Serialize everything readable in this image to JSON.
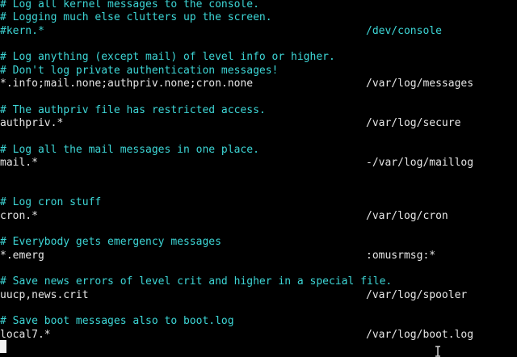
{
  "colors": {
    "background": "#000000",
    "comment": "#3dd6d6",
    "text": "#e6e6e6"
  },
  "lines": [
    {
      "kind": "comment",
      "text": "# Log all kernel messages to the console."
    },
    {
      "kind": "comment",
      "text": "# Logging much else clutters up the screen."
    },
    {
      "kind": "rule",
      "selector": "#kern.*",
      "action": "/dev/console",
      "selector_color": "comment",
      "action_color": "comment"
    },
    {
      "kind": "blank"
    },
    {
      "kind": "comment",
      "text": "# Log anything (except mail) of level info or higher."
    },
    {
      "kind": "comment",
      "text": "# Don't log private authentication messages!"
    },
    {
      "kind": "rule",
      "selector": "*.info;mail.none;authpriv.none;cron.none",
      "action": "/var/log/messages"
    },
    {
      "kind": "blank"
    },
    {
      "kind": "comment",
      "text": "# The authpriv file has restricted access."
    },
    {
      "kind": "rule",
      "selector": "authpriv.*",
      "action": "/var/log/secure"
    },
    {
      "kind": "blank"
    },
    {
      "kind": "comment",
      "text": "# Log all the mail messages in one place."
    },
    {
      "kind": "rule",
      "selector": "mail.*",
      "action": "-/var/log/maillog"
    },
    {
      "kind": "blank"
    },
    {
      "kind": "blank"
    },
    {
      "kind": "comment",
      "text": "# Log cron stuff"
    },
    {
      "kind": "rule",
      "selector": "cron.*",
      "action": "/var/log/cron"
    },
    {
      "kind": "blank"
    },
    {
      "kind": "comment",
      "text": "# Everybody gets emergency messages"
    },
    {
      "kind": "rule",
      "selector": "*.emerg",
      "action": ":omusrmsg:*"
    },
    {
      "kind": "blank"
    },
    {
      "kind": "comment",
      "text": "# Save news errors of level crit and higher in a special file."
    },
    {
      "kind": "rule",
      "selector": "uucp,news.crit",
      "action": "/var/log/spooler"
    },
    {
      "kind": "blank"
    },
    {
      "kind": "comment",
      "text": "# Save boot messages also to boot.log"
    },
    {
      "kind": "rule",
      "selector": "local7.*",
      "action": "/var/log/boot.log"
    }
  ]
}
